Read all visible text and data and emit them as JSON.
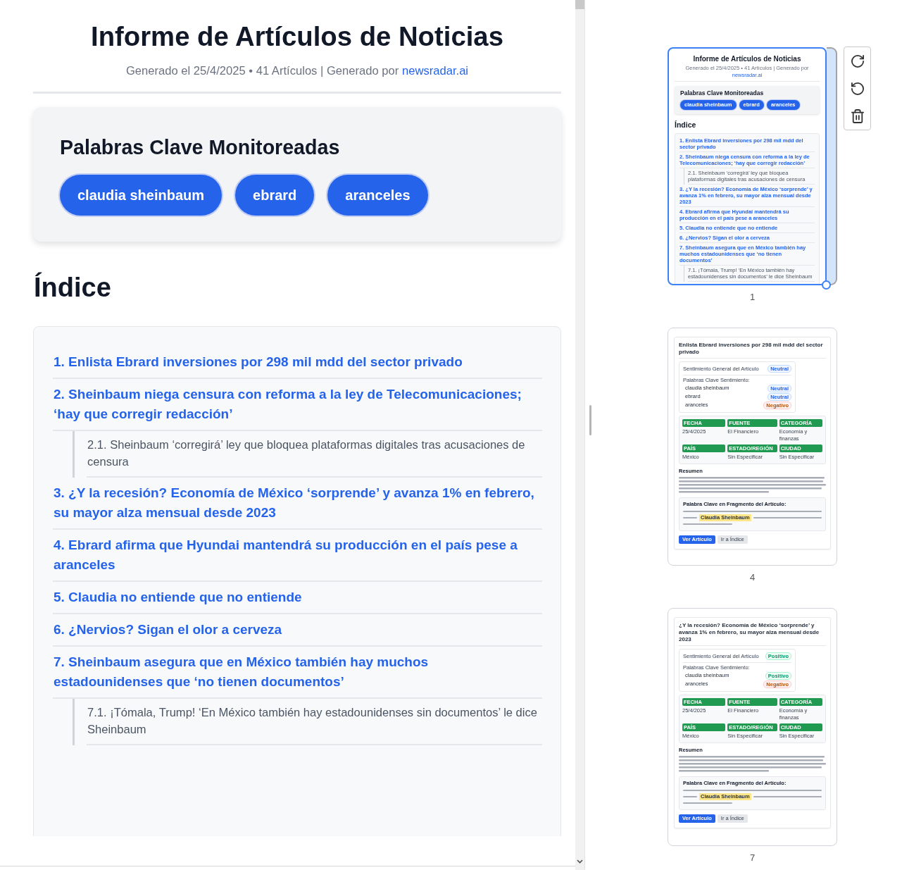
{
  "document": {
    "title": "Informe de Artículos de Noticias",
    "meta": {
      "text": "Generado el 25/4/2025 • 41 Artículos | Generado por",
      "link": "newsradar.ai"
    },
    "keywords": {
      "heading": "Palabras Clave Monitoreadas",
      "items": [
        "claudia sheinbaum",
        "ebrard",
        "aranceles"
      ]
    },
    "index": {
      "heading": "Índice",
      "items": [
        {
          "label": "1. Enlista Ebrard inversiones por 298 mil mdd del sector privado"
        },
        {
          "label": "2. Sheinbaum niega censura con reforma a la ley de Telecomunicaciones; ‘hay que corregir redacción’",
          "children": [
            {
              "label": "2.1. Sheinbaum ‘corregirá’ ley que bloquea plataformas digitales tras acusaciones de censura"
            }
          ]
        },
        {
          "label": "3. ¿Y la recesión? Economía de México ‘sorprende’ y avanza 1% en febrero, su mayor alza mensual desde 2023"
        },
        {
          "label": "4. Ebrard afirma que Hyundai mantendrá su producción en el país pese a aranceles"
        },
        {
          "label": "5. Claudia no entiende que no entiende"
        },
        {
          "label": "6. ¿Nervios? Sigan el olor a cerveza"
        },
        {
          "label": "7. Sheinbaum asegura que en México también hay muchos estadounidenses que ‘no tienen documentos’",
          "children": [
            {
              "label": "7.1. ¡Tómala, Trump! ‘En México también hay estadounidenses sin documentos’ le dice Sheinbaum"
            }
          ]
        }
      ]
    }
  },
  "thumbnails": [
    {
      "page_number": "1",
      "selected": true,
      "kind": "report",
      "document": {
        "title": "Informe de Artículos de Noticias",
        "meta": {
          "text": "Generado el 25/4/2025 • 41 Artículos | Generado por",
          "link": "newsradar.ai"
        },
        "keywords": {
          "heading": "Palabras Clave Monitoreadas",
          "items": [
            "claudia sheinbaum",
            "ebrard",
            "aranceles"
          ]
        },
        "index": {
          "heading": "Índice",
          "items": [
            {
              "label": "1. Enlista Ebrard inversiones por 298 mil mdd del sector privado"
            },
            {
              "label": "2. Sheinbaum niega censura con reforma a la ley de Telecomunicaciones; ‘hay que corregir redacción’",
              "children": [
                {
                  "label": "2.1. Sheinbaum ‘corregirá’ ley que bloquea plataformas digitales tras acusaciones de censura"
                }
              ]
            },
            {
              "label": "3. ¿Y la recesión? Economía de México ‘sorprende’ y avanza 1% en febrero, su mayor alza mensual desde 2023"
            },
            {
              "label": "4. Ebrard afirma que Hyundai mantendrá su producción en el país pese a aranceles"
            },
            {
              "label": "5. Claudia no entiende que no entiende"
            },
            {
              "label": "6. ¿Nervios? Sigan el olor a cerveza"
            },
            {
              "label": "7. Sheinbaum asegura que en México también hay muchos estadounidenses que ‘no tienen documentos’",
              "children": [
                {
                  "label": "7.1. ¡Tómala, Trump! ‘En México también hay estadounidenses sin documentos’ le dice Sheinbaum"
                }
              ]
            }
          ]
        }
      }
    },
    {
      "page_number": "4",
      "selected": false,
      "kind": "article",
      "article": {
        "title": "Enlista Ebrard inversiones por 298 mil mdd del sector privado",
        "sentiment": {
          "general_label": "Sentimiento General del Artículo",
          "general": {
            "text": "Neutral",
            "kind": "neutral"
          },
          "keywords_label": "Palabras Clave Sentimiento:",
          "keywords": [
            {
              "keyword": "claudia sheinbaum",
              "text": "Neutral",
              "kind": "neutral"
            },
            {
              "keyword": "ebrard",
              "text": "Neutral",
              "kind": "neutral"
            },
            {
              "keyword": "aranceles",
              "text": "Negativo",
              "kind": "negative"
            }
          ]
        },
        "metadata": [
          {
            "label": "FECHA",
            "value": "25/4/2025"
          },
          {
            "label": "FUENTE",
            "value": "El Financiero"
          },
          {
            "label": "CATEGORÍA",
            "value": "Economía y finanzas"
          },
          {
            "label": "PAÍS",
            "value": "México"
          },
          {
            "label": "ESTADO/REGIÓN",
            "value": "Sin Especificar"
          },
          {
            "label": "CIUDAD",
            "value": "Sin Especificar"
          }
        ],
        "summary_heading": "Resumen",
        "fragment": {
          "heading": "Palabra Clave en Fragmento del Artículo:",
          "highlight": "Claudia Sheinbaum"
        },
        "buttons": [
          {
            "label": "Ver Artículo",
            "kind": "primary"
          },
          {
            "label": "Ir a Índice",
            "kind": "secondary"
          }
        ]
      }
    },
    {
      "page_number": "7",
      "selected": false,
      "kind": "article",
      "article": {
        "title": "¿Y la recesión? Economía de México ‘sorprende’ y avanza 1% en febrero, su mayor alza mensual desde 2023",
        "sentiment": {
          "general_label": "Sentimiento General del Artículo",
          "general": {
            "text": "Positivo",
            "kind": "positive"
          },
          "keywords_label": "Palabras Clave Sentimiento:",
          "keywords": [
            {
              "keyword": "claudia sheinbaum",
              "text": "Positivo",
              "kind": "positive"
            },
            {
              "keyword": "aranceles",
              "text": "Negativo",
              "kind": "negative"
            }
          ]
        },
        "metadata": [
          {
            "label": "FECHA",
            "value": "25/4/2025"
          },
          {
            "label": "FUENTE",
            "value": "El Financiero"
          },
          {
            "label": "CATEGORÍA",
            "value": "Economía y finanzas"
          },
          {
            "label": "PAÍS",
            "value": "México"
          },
          {
            "label": "ESTADO/REGIÓN",
            "value": "Sin Especificar"
          },
          {
            "label": "CIUDAD",
            "value": "Sin Especificar"
          }
        ],
        "summary_heading": "Resumen",
        "fragment": {
          "heading": "Palabra Clave en Fragmento del Artículo:",
          "highlight": "Claudia Sheinbaum"
        },
        "buttons": [
          {
            "label": "Ver Artículo",
            "kind": "primary"
          },
          {
            "label": "Ir a Índice",
            "kind": "secondary"
          }
        ]
      }
    }
  ],
  "toolbar": [
    {
      "kind": "rotate_cw"
    },
    {
      "kind": "rotate_ccw"
    },
    {
      "kind": "delete"
    }
  ]
}
